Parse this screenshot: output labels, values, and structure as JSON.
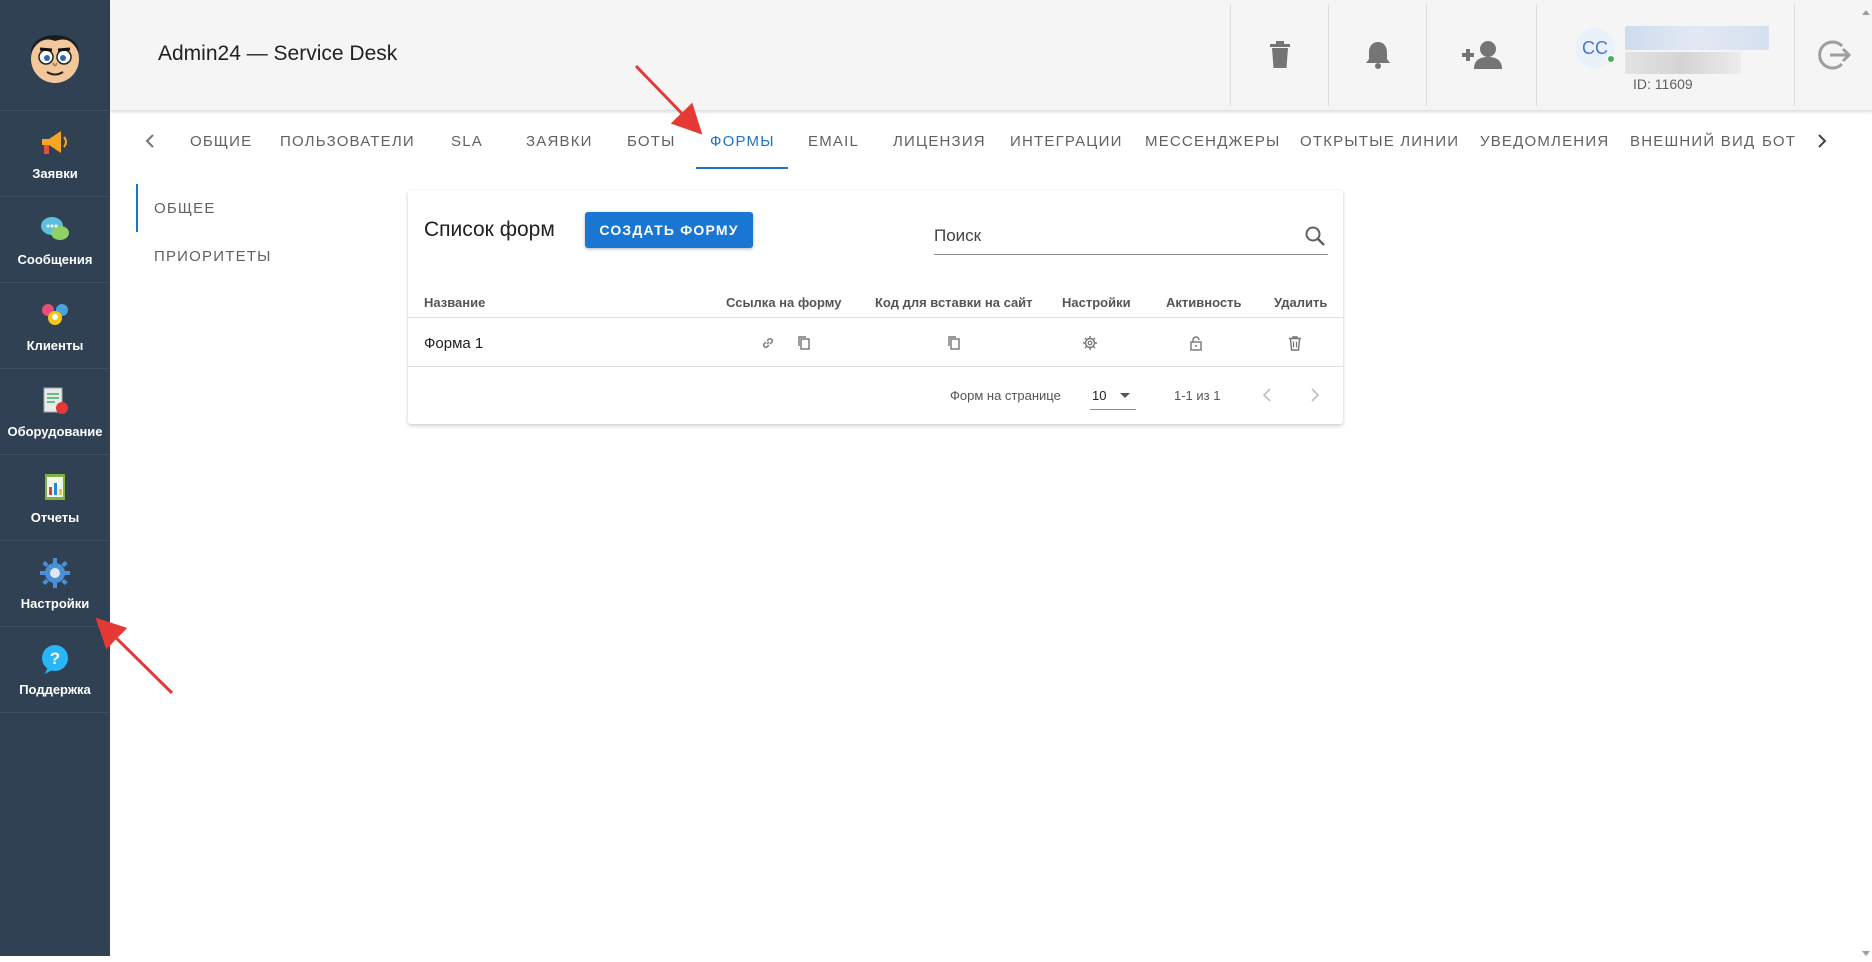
{
  "app": {
    "title": "Admin24 — Service Desk"
  },
  "sidebar": {
    "items": [
      {
        "label": "Заявки",
        "icon": "megaphone-icon"
      },
      {
        "label": "Сообщения",
        "icon": "chat-bubbles-icon"
      },
      {
        "label": "Клиенты",
        "icon": "clients-icon"
      },
      {
        "label": "Оборудование",
        "icon": "equipment-icon"
      },
      {
        "label": "Отчеты",
        "icon": "report-icon"
      },
      {
        "label": "Настройки",
        "icon": "gear-icon"
      },
      {
        "label": "Поддержка",
        "icon": "help-icon"
      }
    ]
  },
  "header": {
    "user": {
      "initials": "CC",
      "id_text": "ID: 11609"
    }
  },
  "tabs": [
    "ОБЩИЕ",
    "ПОЛЬЗОВАТЕЛИ",
    "SLA",
    "ЗАЯВКИ",
    "БОТЫ",
    "ФОРМЫ",
    "EMAIL",
    "ЛИЦЕНЗИЯ",
    "ИНТЕГРАЦИИ",
    "МЕССЕНДЖЕРЫ",
    "ОТКРЫТЫЕ ЛИНИИ",
    "УВЕДОМЛЕНИЯ",
    "ВНЕШНИЙ ВИД",
    "БОТ"
  ],
  "active_tab": "ФОРМЫ",
  "subnav": [
    "ОБЩЕЕ",
    "ПРИОРИТЕТЫ"
  ],
  "forms": {
    "title": "Список форм",
    "create_label": "СОЗДАТЬ ФОРМУ",
    "search_placeholder": "Поиск",
    "columns": [
      "Название",
      "Ссылка на форму",
      "Код для вставки на сайт",
      "Настройки",
      "Активность",
      "Удалить"
    ],
    "rows": [
      {
        "name": "Форма 1"
      }
    ],
    "footer": {
      "per_page_label": "Форм на странице",
      "per_page": "10",
      "range": "1-1 из 1"
    }
  },
  "colors": {
    "sidebar": "#2f4153",
    "accent": "#1976d2",
    "annotation": "#e53935"
  }
}
